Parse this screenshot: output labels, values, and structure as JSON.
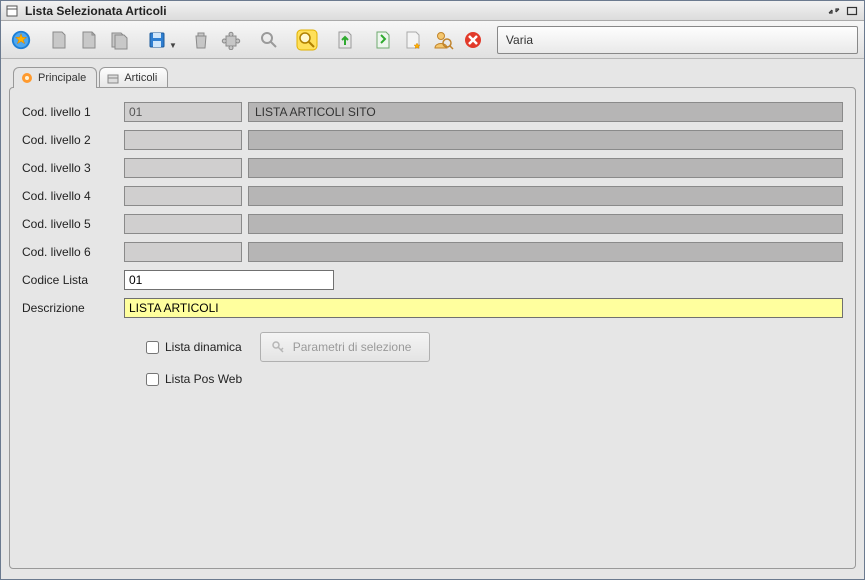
{
  "window": {
    "title": "Lista Selezionata Articoli"
  },
  "mode": "Varia",
  "tabs": {
    "principale": "Principale",
    "articoli": "Articoli"
  },
  "labels": {
    "cod1": "Cod. livello 1",
    "cod2": "Cod. livello 2",
    "cod3": "Cod. livello 3",
    "cod4": "Cod. livello 4",
    "cod5": "Cod. livello 5",
    "cod6": "Cod. livello 6",
    "codiceLista": "Codice Lista",
    "descrizione": "Descrizione",
    "listaDinamica": "Lista dinamica",
    "paramBtn": "Parametri di selezione",
    "listaPosWeb": "Lista Pos Web"
  },
  "values": {
    "cod1": "01",
    "desc1": "LISTA ARTICOLI SITO",
    "cod2": "",
    "desc2": "",
    "cod3": "",
    "desc3": "",
    "cod4": "",
    "desc4": "",
    "cod5": "",
    "desc5": "",
    "cod6": "",
    "desc6": "",
    "codiceLista": "01",
    "descrizione": "LISTA ARTICOLI"
  }
}
